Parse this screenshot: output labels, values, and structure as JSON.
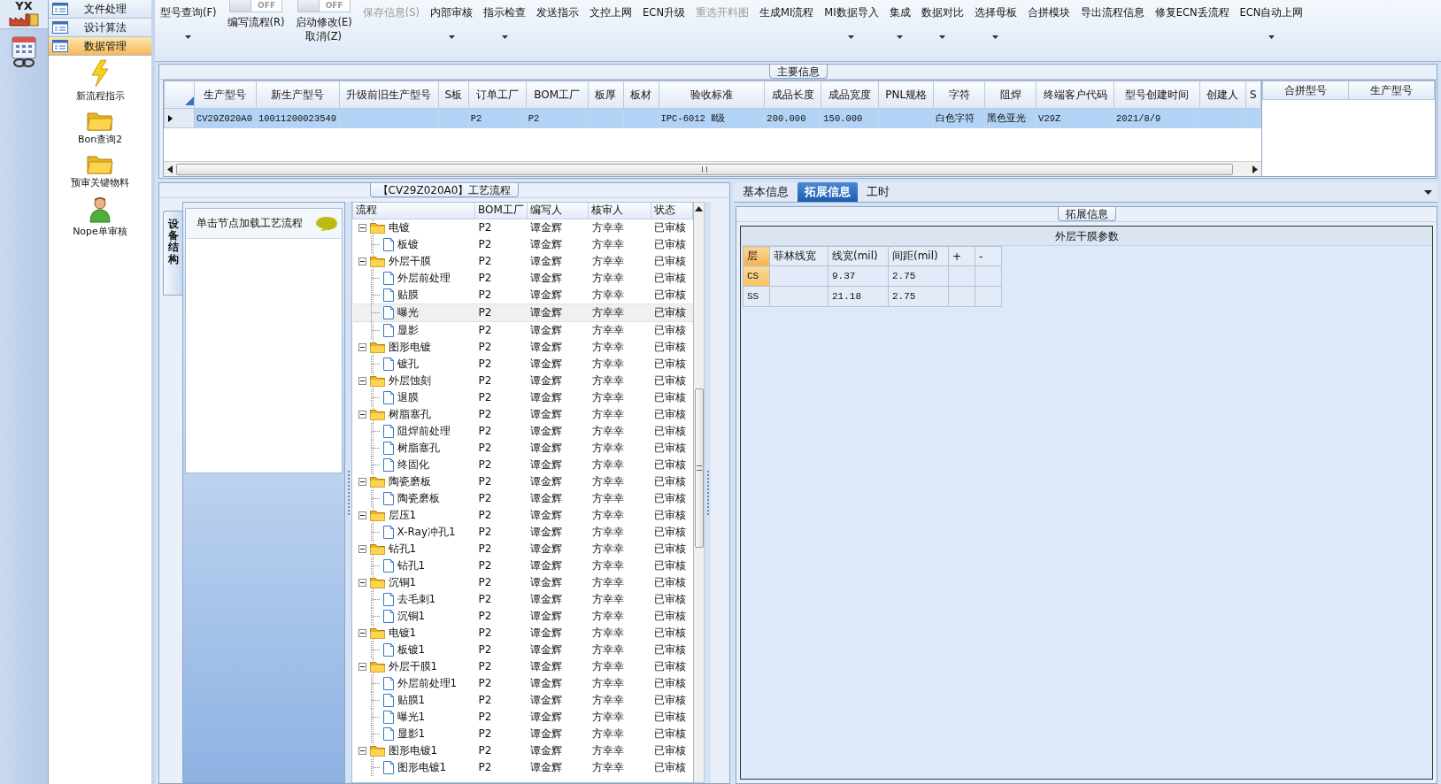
{
  "sidebar": {
    "logo_text": "YX"
  },
  "nav": {
    "items": [
      {
        "label": "文件处理",
        "selected": false
      },
      {
        "label": "设计算法",
        "selected": false
      },
      {
        "label": "数据管理",
        "selected": true
      }
    ],
    "shortcuts": [
      {
        "kind": "lightning",
        "label": "新流程指示"
      },
      {
        "kind": "folder",
        "label": "Bon查询2"
      },
      {
        "kind": "folder",
        "label": "预审关键物料"
      },
      {
        "kind": "person",
        "label": "Nope单审核"
      }
    ]
  },
  "toolbar": {
    "items": [
      {
        "kind": "button",
        "label": "型号查询(F)",
        "dropdown": true,
        "disabled": false
      },
      {
        "kind": "toggle",
        "on": false,
        "text": "OFF",
        "buttons": [
          {
            "label": "编写流程(R)",
            "dropdown": false,
            "disabled": false
          }
        ]
      },
      {
        "kind": "toggle",
        "on": false,
        "text": "OFF",
        "buttons": [
          {
            "label": "启动修改(E)",
            "dropdown": false,
            "disabled": false
          },
          {
            "label": "取消(Z)",
            "dropdown": false,
            "disabled": false
          }
        ]
      },
      {
        "kind": "button",
        "label": "保存信息(S)",
        "dropdown": false,
        "disabled": true
      },
      {
        "kind": "button",
        "label": "内部审核",
        "dropdown": true,
        "disabled": false
      },
      {
        "kind": "button",
        "label": "指示检查",
        "dropdown": true,
        "disabled": false
      },
      {
        "kind": "button",
        "label": "发送指示",
        "dropdown": false,
        "disabled": false
      },
      {
        "kind": "button",
        "label": "文控上网",
        "dropdown": false,
        "disabled": false
      },
      {
        "kind": "button",
        "label": "ECN升级",
        "dropdown": false,
        "disabled": false
      },
      {
        "kind": "button",
        "label": "重选开料图",
        "dropdown": false,
        "disabled": true
      },
      {
        "kind": "button",
        "label": "生成MI流程",
        "dropdown": false,
        "disabled": false
      },
      {
        "kind": "button",
        "label": "MI数据导入",
        "dropdown": true,
        "disabled": false
      },
      {
        "kind": "button",
        "label": "集成",
        "dropdown": true,
        "disabled": false
      },
      {
        "kind": "button",
        "label": "数据对比",
        "dropdown": true,
        "disabled": false
      },
      {
        "kind": "button",
        "label": "选择母板",
        "dropdown": true,
        "disabled": false
      },
      {
        "kind": "button",
        "label": "合拼模块",
        "dropdown": false,
        "disabled": false
      },
      {
        "kind": "button",
        "label": "导出流程信息",
        "dropdown": false,
        "disabled": false
      },
      {
        "kind": "button",
        "label": "修复ECN丢流程",
        "dropdown": false,
        "disabled": false
      },
      {
        "kind": "button",
        "label": "ECN自动上网",
        "dropdown": true,
        "disabled": false
      }
    ]
  },
  "main_info": {
    "title": "主要信息",
    "columns": [
      "生产型号",
      "新生产型号",
      "升级前旧生产型号",
      "S板",
      "订单工厂",
      "BOM工厂",
      "板厚",
      "板材",
      "验收标准",
      "成品长度",
      "成品宽度",
      "PNL规格",
      "字符",
      "阻焊",
      "终端客户代码",
      "型号创建时间",
      "创建人",
      "S"
    ],
    "rows": [
      {
        "selected": true,
        "cells": [
          "CV29Z020A0",
          "10011200023549",
          null,
          null,
          "P2",
          "P2",
          null,
          null,
          "IPC-6012 Ⅱ级",
          "200.000",
          "150.000",
          null,
          "白色字符",
          "黑色亚光",
          "V29Z",
          "2021/8/9",
          null,
          null
        ]
      }
    ],
    "side_columns": [
      "合拼型号",
      "生产型号"
    ]
  },
  "process_panel": {
    "title": "【CV29Z020A0】工艺流程",
    "side_tab": "设备结构",
    "hint": "单击节点加载工艺流程",
    "tree": {
      "columns": [
        "流程",
        "BOM工厂",
        "编写人",
        "核审人",
        "状态"
      ],
      "items": [
        {
          "label": "电镀",
          "cells": [
            "P2",
            "谭金辉",
            "方幸幸",
            "已审核"
          ],
          "expanded": true,
          "selected": false,
          "children": [
            {
              "label": "板镀",
              "cells": [
                "P2",
                "谭金辉",
                "方幸幸",
                "已审核"
              ],
              "selected": false
            }
          ]
        },
        {
          "label": "外层干膜",
          "cells": [
            "P2",
            "谭金辉",
            "方幸幸",
            "已审核"
          ],
          "expanded": true,
          "selected": false,
          "children": [
            {
              "label": "外层前处理",
              "cells": [
                "P2",
                "谭金辉",
                "方幸幸",
                "已审核"
              ],
              "selected": false
            },
            {
              "label": "贴膜",
              "cells": [
                "P2",
                "谭金辉",
                "方幸幸",
                "已审核"
              ],
              "selected": false
            },
            {
              "label": "曝光",
              "cells": [
                "P2",
                "谭金辉",
                "方幸幸",
                "已审核"
              ],
              "selected": true
            },
            {
              "label": "显影",
              "cells": [
                "P2",
                "谭金辉",
                "方幸幸",
                "已审核"
              ],
              "selected": false
            }
          ]
        },
        {
          "label": "图形电镀",
          "cells": [
            "P2",
            "谭金辉",
            "方幸幸",
            "已审核"
          ],
          "expanded": true,
          "selected": false,
          "children": [
            {
              "label": "镀孔",
              "cells": [
                "P2",
                "谭金辉",
                "方幸幸",
                "已审核"
              ],
              "selected": false
            }
          ]
        },
        {
          "label": "外层蚀刻",
          "cells": [
            "P2",
            "谭金辉",
            "方幸幸",
            "已审核"
          ],
          "expanded": true,
          "selected": false,
          "children": [
            {
              "label": "退膜",
              "cells": [
                "P2",
                "谭金辉",
                "方幸幸",
                "已审核"
              ],
              "selected": false
            }
          ]
        },
        {
          "label": "树脂塞孔",
          "cells": [
            "P2",
            "谭金辉",
            "方幸幸",
            "已审核"
          ],
          "expanded": true,
          "selected": false,
          "children": [
            {
              "label": "阻焊前处理",
              "cells": [
                "P2",
                "谭金辉",
                "方幸幸",
                "已审核"
              ],
              "selected": false
            },
            {
              "label": "树脂塞孔",
              "cells": [
                "P2",
                "谭金辉",
                "方幸幸",
                "已审核"
              ],
              "selected": false
            },
            {
              "label": "终固化",
              "cells": [
                "P2",
                "谭金辉",
                "方幸幸",
                "已审核"
              ],
              "selected": false
            }
          ]
        },
        {
          "label": "陶瓷磨板",
          "cells": [
            "P2",
            "谭金辉",
            "方幸幸",
            "已审核"
          ],
          "expanded": true,
          "selected": false,
          "children": [
            {
              "label": "陶瓷磨板",
              "cells": [
                "P2",
                "谭金辉",
                "方幸幸",
                "已审核"
              ],
              "selected": false
            }
          ]
        },
        {
          "label": "层压1",
          "cells": [
            "P2",
            "谭金辉",
            "方幸幸",
            "已审核"
          ],
          "expanded": true,
          "selected": false,
          "children": [
            {
              "label": "X-Ray冲孔1",
              "cells": [
                "P2",
                "谭金辉",
                "方幸幸",
                "已审核"
              ],
              "selected": false
            }
          ]
        },
        {
          "label": "钻孔1",
          "cells": [
            "P2",
            "谭金辉",
            "方幸幸",
            "已审核"
          ],
          "expanded": true,
          "selected": false,
          "children": [
            {
              "label": "钻孔1",
              "cells": [
                "P2",
                "谭金辉",
                "方幸幸",
                "已审核"
              ],
              "selected": false
            }
          ]
        },
        {
          "label": "沉铜1",
          "cells": [
            "P2",
            "谭金辉",
            "方幸幸",
            "已审核"
          ],
          "expanded": true,
          "selected": false,
          "children": [
            {
              "label": "去毛刺1",
              "cells": [
                "P2",
                "谭金辉",
                "方幸幸",
                "已审核"
              ],
              "selected": false
            },
            {
              "label": "沉铜1",
              "cells": [
                "P2",
                "谭金辉",
                "方幸幸",
                "已审核"
              ],
              "selected": false
            }
          ]
        },
        {
          "label": "电镀1",
          "cells": [
            "P2",
            "谭金辉",
            "方幸幸",
            "已审核"
          ],
          "expanded": true,
          "selected": false,
          "children": [
            {
              "label": "板镀1",
              "cells": [
                "P2",
                "谭金辉",
                "方幸幸",
                "已审核"
              ],
              "selected": false
            }
          ]
        },
        {
          "label": "外层干膜1",
          "cells": [
            "P2",
            "谭金辉",
            "方幸幸",
            "已审核"
          ],
          "expanded": true,
          "selected": false,
          "children": [
            {
              "label": "外层前处理1",
              "cells": [
                "P2",
                "谭金辉",
                "方幸幸",
                "已审核"
              ],
              "selected": false
            },
            {
              "label": "贴膜1",
              "cells": [
                "P2",
                "谭金辉",
                "方幸幸",
                "已审核"
              ],
              "selected": false
            },
            {
              "label": "曝光1",
              "cells": [
                "P2",
                "谭金辉",
                "方幸幸",
                "已审核"
              ],
              "selected": false
            },
            {
              "label": "显影1",
              "cells": [
                "P2",
                "谭金辉",
                "方幸幸",
                "已审核"
              ],
              "selected": false
            }
          ]
        },
        {
          "label": "图形电镀1",
          "cells": [
            "P2",
            "谭金辉",
            "方幸幸",
            "已审核"
          ],
          "expanded": true,
          "selected": false,
          "children": [
            {
              "label": "图形电镀1",
              "cells": [
                "P2",
                "谭金辉",
                "方幸幸",
                "已审核"
              ],
              "selected": false
            }
          ]
        }
      ]
    }
  },
  "detail_panel": {
    "tabs": [
      {
        "label": "基本信息",
        "selected": false
      },
      {
        "label": "拓展信息",
        "selected": true
      },
      {
        "label": "工时",
        "selected": false
      }
    ],
    "group_title": "拓展信息",
    "table_title": "外层干膜参数",
    "columns": [
      "层",
      "菲林线宽",
      "线宽(mil)",
      "间距(mil)",
      "+",
      "-"
    ],
    "rows": [
      {
        "selected": true,
        "cells": [
          "CS",
          null,
          "9.37",
          "2.75",
          null,
          null
        ]
      },
      {
        "selected": false,
        "cells": [
          "SS",
          null,
          "21.18",
          "2.75",
          null,
          null
        ]
      }
    ]
  }
}
